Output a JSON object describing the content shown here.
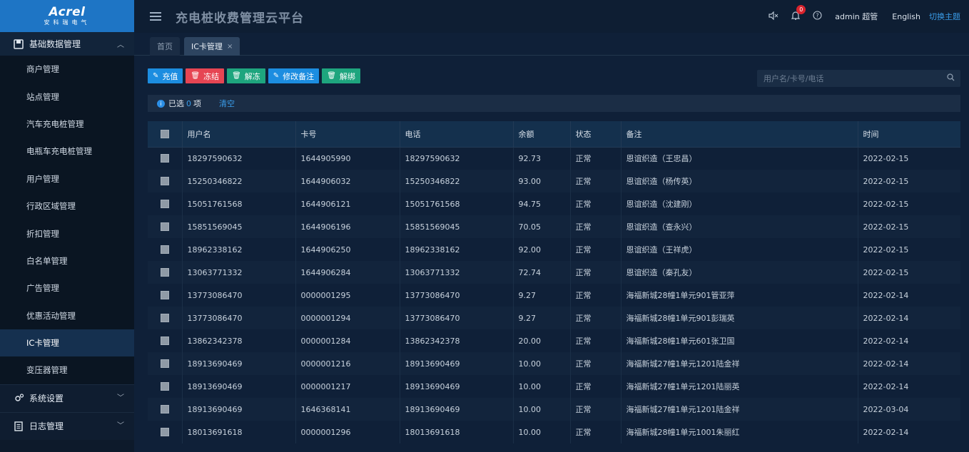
{
  "logo": {
    "brand": "Acrel",
    "brand_cn": "安科瑞电气"
  },
  "sidebar": {
    "group_basic": "基础数据管理",
    "items": [
      {
        "label": "商户管理"
      },
      {
        "label": "站点管理"
      },
      {
        "label": "汽车充电桩管理"
      },
      {
        "label": "电瓶车充电桩管理"
      },
      {
        "label": "用户管理"
      },
      {
        "label": "行政区域管理"
      },
      {
        "label": "折扣管理"
      },
      {
        "label": "白名单管理"
      },
      {
        "label": "广告管理"
      },
      {
        "label": "优惠活动管理"
      },
      {
        "label": "IC卡管理",
        "active": true
      },
      {
        "label": "变压器管理"
      }
    ],
    "group_system": "系统设置",
    "group_log": "日志管理"
  },
  "header": {
    "title": "充电桩收费管理云平台",
    "notification_count": "0",
    "user": "admin 超管",
    "language": "English",
    "theme_switch": "切换主题"
  },
  "tabs": {
    "home": "首页",
    "current": "IC卡管理"
  },
  "toolbar": {
    "recharge": "充值",
    "freeze": "冻结",
    "unfreeze": "解冻",
    "edit_note": "修改备注",
    "unbind": "解绑"
  },
  "search": {
    "placeholder": "用户名/卡号/电话"
  },
  "selection": {
    "prefix": "已选",
    "count": "0",
    "suffix": "项",
    "clear": "清空"
  },
  "table": {
    "headers": [
      "用户名",
      "卡号",
      "电话",
      "余额",
      "状态",
      "备注",
      "时间"
    ],
    "rows": [
      [
        "18297590632",
        "1644905990",
        "18297590632",
        "92.73",
        "正常",
        "恩谊织造（王忠昌）",
        "2022-02-15"
      ],
      [
        "15250346822",
        "1644906032",
        "15250346822",
        "93.00",
        "正常",
        "恩谊织造（杨传英）",
        "2022-02-15"
      ],
      [
        "15051761568",
        "1644906121",
        "15051761568",
        "94.75",
        "正常",
        "恩谊织造（沈建刚）",
        "2022-02-15"
      ],
      [
        "15851569045",
        "1644906196",
        "15851569045",
        "70.05",
        "正常",
        "恩谊织造（查永兴）",
        "2022-02-15"
      ],
      [
        "18962338162",
        "1644906250",
        "18962338162",
        "92.00",
        "正常",
        "恩谊织造（王祥虎）",
        "2022-02-15"
      ],
      [
        "13063771332",
        "1644906284",
        "13063771332",
        "72.74",
        "正常",
        "恩谊织造（秦孔友）",
        "2022-02-15"
      ],
      [
        "13773086470",
        "0000001295",
        "13773086470",
        "9.27",
        "正常",
        "海福新城28幢1单元901管亚萍",
        "2022-02-14"
      ],
      [
        "13773086470",
        "0000001294",
        "13773086470",
        "9.27",
        "正常",
        "海福新城28幢1单元901彭瑞英",
        "2022-02-14"
      ],
      [
        "13862342378",
        "0000001284",
        "13862342378",
        "20.00",
        "正常",
        "海福新城28幢1单元601张卫国",
        "2022-02-14"
      ],
      [
        "18913690469",
        "0000001216",
        "18913690469",
        "10.00",
        "正常",
        "海福新城27幢1单元1201陆金祥",
        "2022-02-14"
      ],
      [
        "18913690469",
        "0000001217",
        "18913690469",
        "10.00",
        "正常",
        "海福新城27幢1单元1201陆丽英",
        "2022-02-14"
      ],
      [
        "18913690469",
        "1646368141",
        "18913690469",
        "10.00",
        "正常",
        "海福新城27幢1单元1201陆金祥",
        "2022-03-04"
      ],
      [
        "18013691618",
        "0000001296",
        "18013691618",
        "10.00",
        "正常",
        "海福新城28幢1单元1001朱丽红",
        "2022-02-14"
      ]
    ]
  }
}
